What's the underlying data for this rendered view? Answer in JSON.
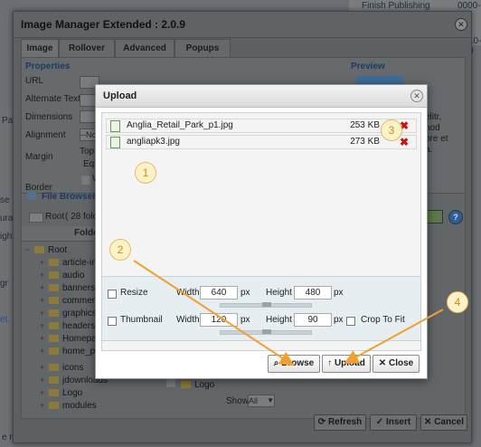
{
  "background": {
    "top_right": [
      "Finish Publishing",
      "0000-0",
      "10-0"
    ],
    "left_fragments": [
      "Par",
      "se",
      "ura",
      "ight",
      "gr",
      "et.",
      "e n"
    ]
  },
  "main_dialog": {
    "title": "Image Manager Extended : 2.0.9",
    "tabs": [
      "Image",
      "Rollover",
      "Advanced",
      "Popups"
    ],
    "properties": {
      "heading": "Properties",
      "labels": [
        "URL",
        "Alternate Text",
        "Dimensions",
        "Alignment",
        "Margin",
        "Border"
      ],
      "alignment_value": "--No",
      "margin_sub": [
        "Top",
        "Equa"
      ],
      "border_check": "W"
    },
    "preview": {
      "heading": "Preview",
      "text_fragments": [
        "elitr,",
        "nod",
        "ore et",
        "a."
      ]
    },
    "file_browser": {
      "heading": "File Browser",
      "root_label": "Root",
      "root_count": "( 28 folde",
      "folders_header": "Folde",
      "tree_root": "Root",
      "folders": [
        "article-image",
        "audio",
        "banners",
        "comments",
        "graphics",
        "headers_ima",
        "Homepage_5",
        "home_page_",
        "icons",
        "jdownloads",
        "Logo",
        "modules"
      ],
      "right_item": "Logo",
      "show_label": "Show",
      "show_value": "All"
    },
    "buttons": {
      "refresh": "Refresh",
      "insert": "Insert",
      "cancel": "Cancel"
    }
  },
  "upload_dialog": {
    "title": "Upload",
    "files": [
      {
        "name": "Anglia_Retail_Park_p1.jpg",
        "size": "253 KB"
      },
      {
        "name": "angliapk3.jpg",
        "size": "273 KB"
      }
    ],
    "resize": {
      "label": "Resize",
      "width_label": "Width",
      "width": "640",
      "width_unit": "px",
      "height_label": "Height",
      "height": "480",
      "height_unit": "px"
    },
    "thumbnail": {
      "label": "Thumbnail",
      "width_label": "Width",
      "width": "120",
      "width_unit": "px",
      "height_label": "Height",
      "height": "90",
      "height_unit": "px",
      "crop_label": "Crop To Fit"
    },
    "buttons": {
      "browse": "Browse",
      "upload": "Upload",
      "close": "Close"
    }
  },
  "annotations": [
    "1",
    "2",
    "3",
    "4"
  ],
  "colors": {
    "arrow": "#f0a030",
    "callout_bg": "#fbf3c8",
    "callout_border": "#e8b860",
    "delete": "#cc1111"
  }
}
